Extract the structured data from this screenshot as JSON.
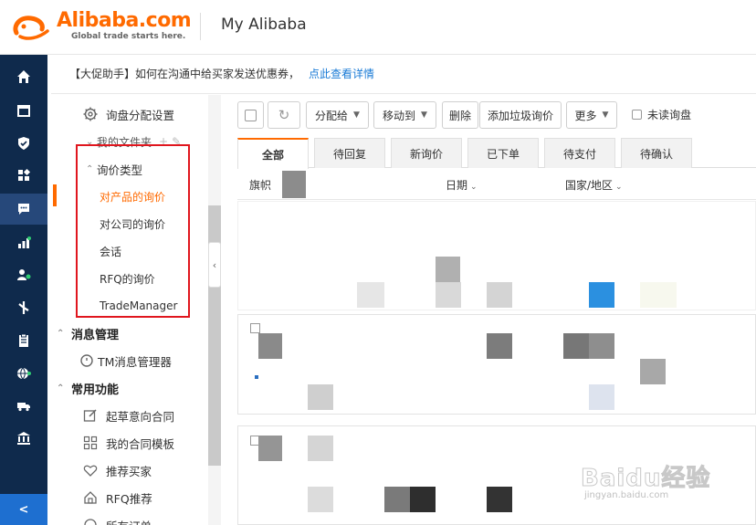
{
  "header": {
    "logo_word": "Alibaba.com",
    "logo_tagline": "Global trade starts here.",
    "app_title": "My Alibaba"
  },
  "rail": {
    "icons": [
      "home-icon",
      "shop-icon",
      "shield-icon",
      "apps-icon",
      "message-icon",
      "chart-icon",
      "users-icon",
      "flow-icon",
      "clipboard-icon",
      "globe-icon",
      "truck-icon",
      "bank-icon"
    ],
    "active_index": 4,
    "collapse_glyph": "<"
  },
  "notice": {
    "text": "【大促助手】如何在沟通中给买家发送优惠券，",
    "link": "点此查看详情"
  },
  "menu": {
    "top_item": "询盘分配设置",
    "my_folder": "我的文件夹",
    "inquiry_type": "询价类型",
    "inquiry_subs": [
      "对产品的询价",
      "对公司的询价",
      "会话",
      "RFQ的询价",
      "TradeManager"
    ],
    "active_sub_index": 0,
    "message_section": "消息管理",
    "tm_manager": "TM消息管理器",
    "common_section": "常用功能",
    "common_items": [
      "起草意向合同",
      "我的合同模板",
      "推荐买家",
      "RFQ推荐",
      "所有订单"
    ]
  },
  "toolbar": {
    "refresh_glyph": "↻",
    "assign": "分配给",
    "move_to": "移动到",
    "delete": "删除",
    "add_spam": "添加垃圾询价",
    "more": "更多",
    "unread": "未读询盘"
  },
  "tabs": [
    "全部",
    "待回复",
    "新询价",
    "已下单",
    "待支付",
    "待确认"
  ],
  "active_tab": 0,
  "columns": {
    "flag": "旗帜",
    "date": "日期",
    "country": "国家/地区"
  },
  "watermark": {
    "word": "Baidu经验",
    "sub": "jingyan.baidu.com"
  },
  "colors": {
    "brand_orange": "#ff6a00",
    "rail_bg": "#0f2a4c",
    "link_blue": "#1a7bd6",
    "highlight_red": "#e0161e"
  }
}
